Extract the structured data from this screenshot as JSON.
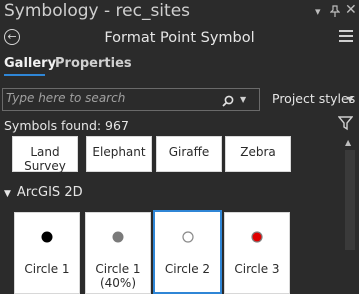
{
  "window": {
    "title": "Symbology - rec_sites",
    "pin_icon": "pin-icon",
    "close_icon": "close-icon",
    "dropdown_icon": "dropdown-arrow-icon"
  },
  "header": {
    "title": "Format Point Symbol",
    "back_icon": "back-arrow-icon",
    "menu_icon": "hamburger-menu-icon"
  },
  "tabs": [
    {
      "label": "Gallery",
      "active": true
    },
    {
      "label": "Properties",
      "active": false
    }
  ],
  "search": {
    "placeholder": "Type here to search",
    "value": ""
  },
  "styles_dropdown": {
    "selected": "Project styles"
  },
  "symbols_found": "Symbols found: 967",
  "gallery": {
    "top_row": [
      "Land Survey",
      "Elephant",
      "Giraffe",
      "Zebra"
    ],
    "group_label": "ArcGIS 2D",
    "symbols": [
      {
        "label": "Circle 1",
        "sublabel": "",
        "fill": "#000000",
        "stroke": "#000000"
      },
      {
        "label": "Circle 1",
        "sublabel": "(40%)",
        "fill": "#7a7a7a",
        "stroke": "#7a7a7a"
      },
      {
        "label": "Circle 2",
        "sublabel": "",
        "fill": "#ffffff",
        "stroke": "#8a8a8a",
        "selected": true
      },
      {
        "label": "Circle 3",
        "sublabel": "",
        "fill": "#e00000",
        "stroke": "#808080"
      }
    ]
  },
  "colors": {
    "background": "#2b2b2b",
    "accent": "#2f86d6",
    "selected_border": "#2f86d6"
  }
}
